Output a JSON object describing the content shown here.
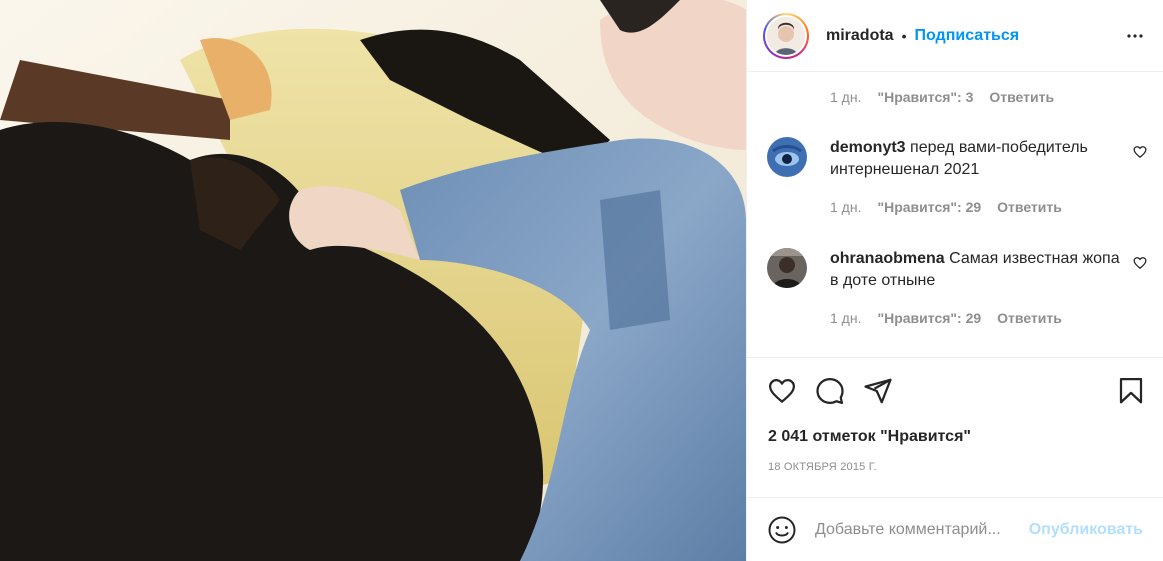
{
  "post": {
    "photo_alt": "Фото",
    "author": {
      "username": "miradota",
      "dot": "•",
      "follow_label": "Подписаться"
    },
    "top_meta": {
      "time": "1 дн.",
      "likes": "\"Нравится\": 3",
      "reply": "Ответить"
    },
    "comments": [
      {
        "username": "demonyt3",
        "text": "перед вами-победитель интернешенал 2021",
        "time": "1 дн.",
        "likes": "\"Нравится\": 29",
        "reply": "Ответить"
      },
      {
        "username": "ohranaobmena",
        "text": "Самая известная жопа в доте отныне",
        "time": "1 дн.",
        "likes": "\"Нравится\": 29",
        "reply": "Ответить"
      }
    ],
    "likes_count": "2 041 отметок \"Нравится\"",
    "date": "18 ОКТЯБРЯ 2015 Г.",
    "add_comment": {
      "placeholder": "Добавьте комментарий...",
      "publish_label": "Опубликовать"
    }
  },
  "colors": {
    "accent": "#0095f6",
    "publish_disabled": "#b2dffc",
    "secondary_text": "#8e8e8e"
  },
  "icons": [
    "more-options-icon",
    "heart-icon",
    "comment-icon",
    "share-icon",
    "bookmark-icon",
    "emoji-icon"
  ]
}
